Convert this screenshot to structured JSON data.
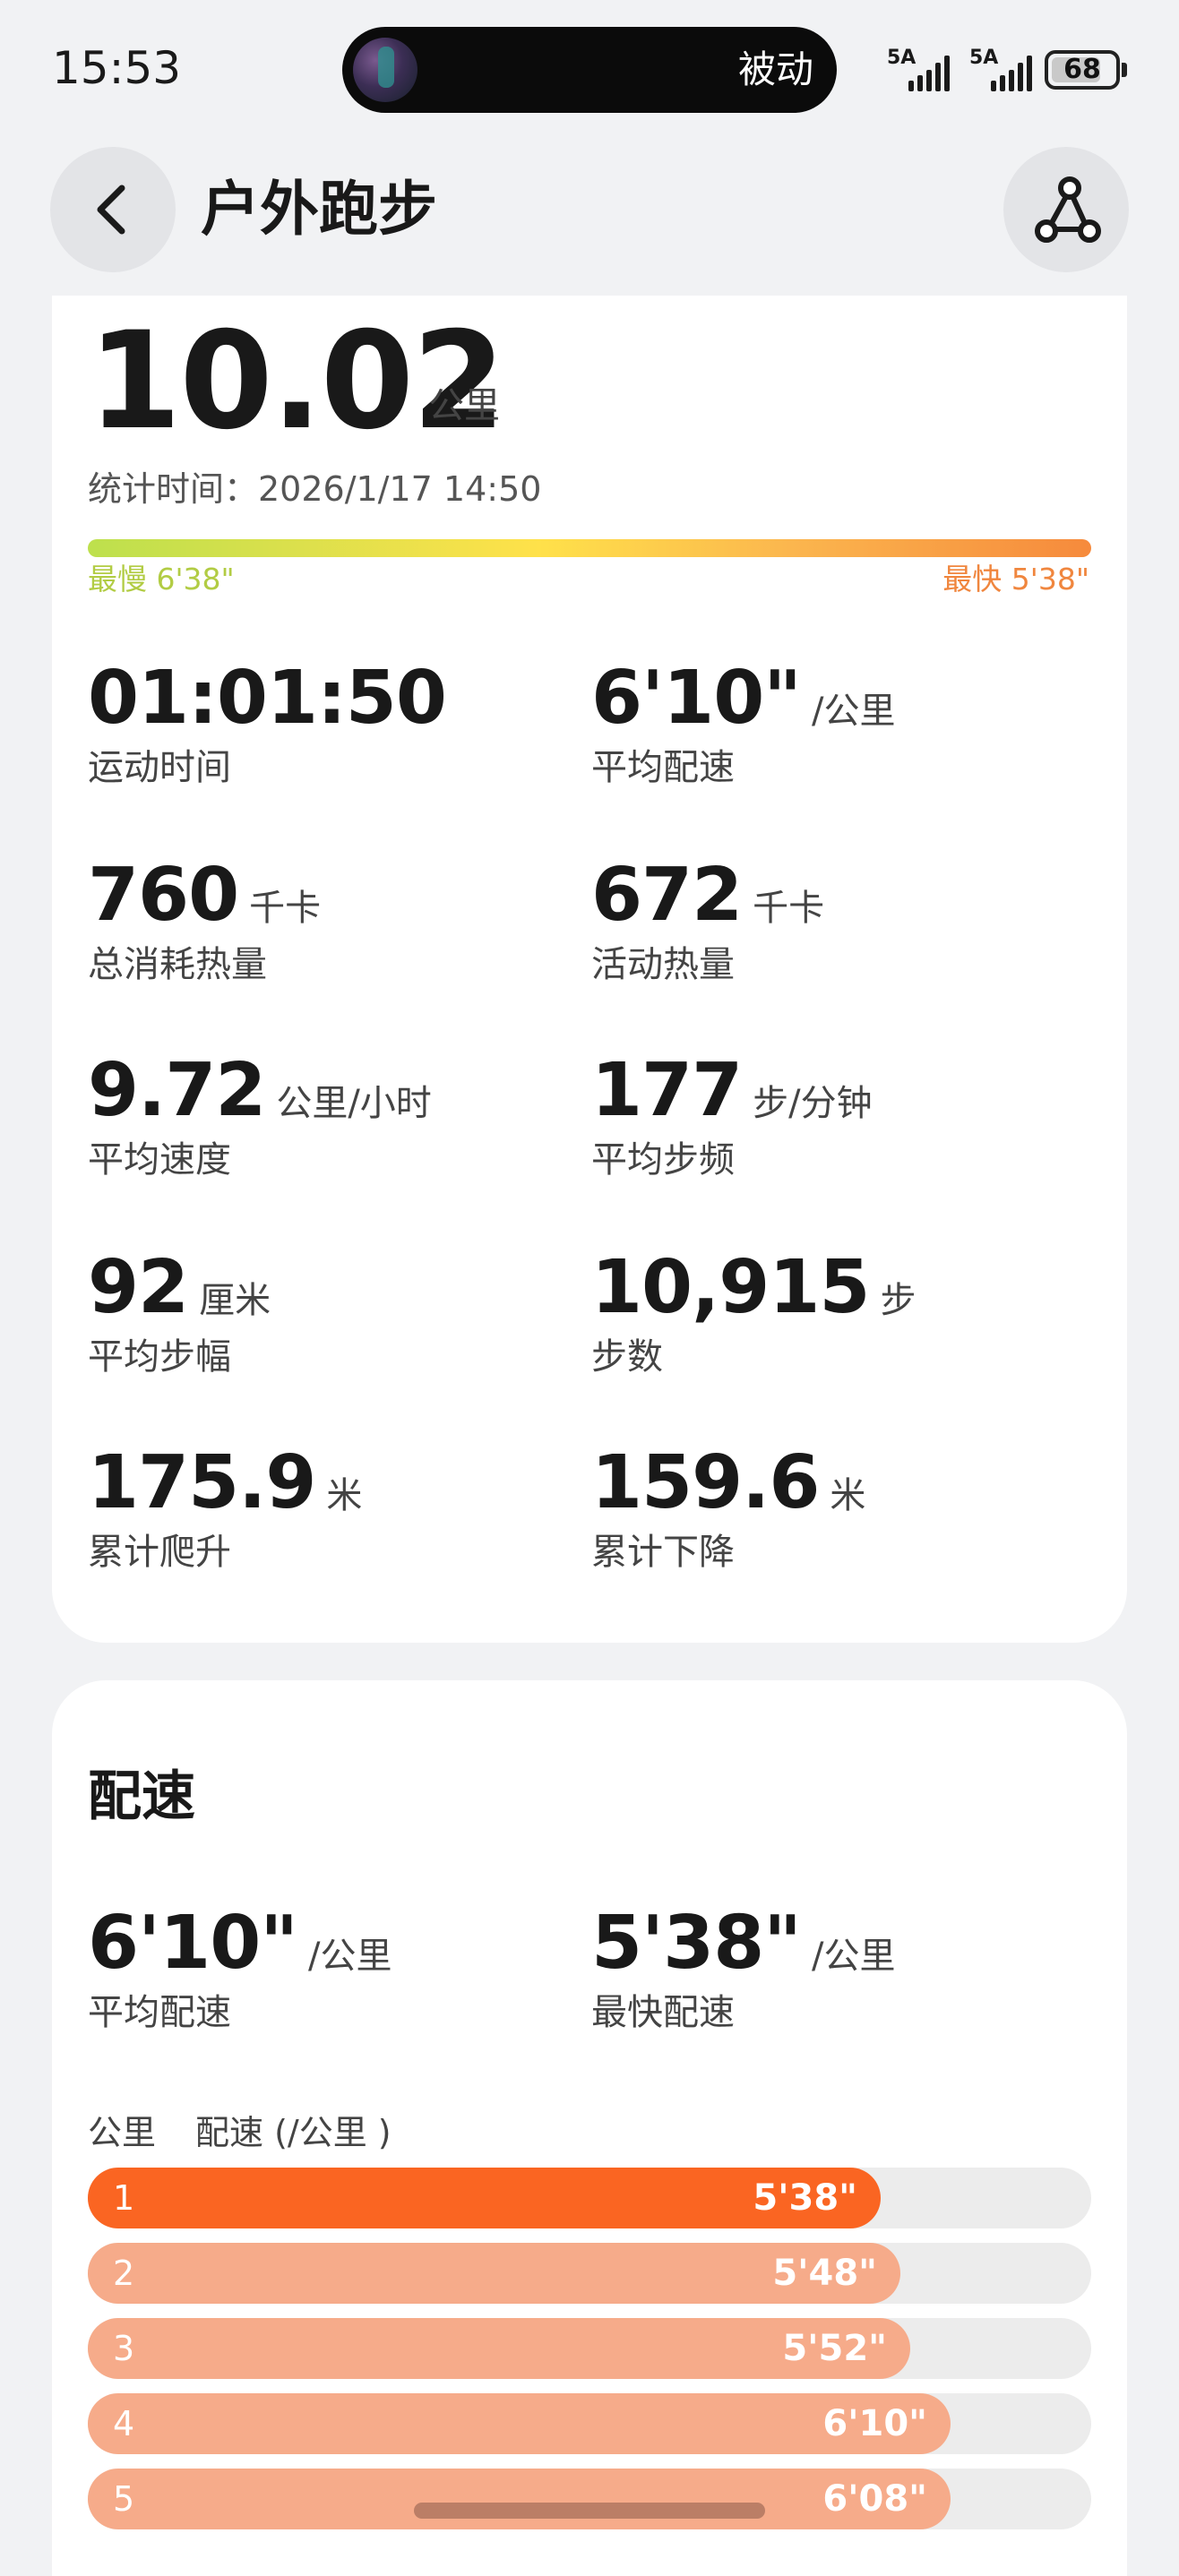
{
  "status_bar": {
    "time": "15:53",
    "activity_label": "被动",
    "signal_1": "5A",
    "signal_2": "5A",
    "battery": "68"
  },
  "header": {
    "title": "户外跑步",
    "back_icon": "chevron-left-icon",
    "share_icon": "route-share-icon"
  },
  "summary": {
    "distance": "10.02",
    "distance_unit": "公里",
    "stat_time": "统计时间：2026/1/17 14:50",
    "slowest": "最慢 6'38\"",
    "fastest": "最快 5'38\""
  },
  "metrics": [
    {
      "value": "01:01:50",
      "unit": "",
      "label": "运动时间"
    },
    {
      "value": "6'10\"",
      "unit": "/公里",
      "label": "平均配速"
    },
    {
      "value": "760",
      "unit": "千卡",
      "label": "总消耗热量"
    },
    {
      "value": "672",
      "unit": "千卡",
      "label": "活动热量"
    },
    {
      "value": "9.72",
      "unit": "公里/小时",
      "label": "平均速度"
    },
    {
      "value": "177",
      "unit": "步/分钟",
      "label": "平均步频"
    },
    {
      "value": "92",
      "unit": "厘米",
      "label": "平均步幅"
    },
    {
      "value": "10,915",
      "unit": "步",
      "label": "步数"
    },
    {
      "value": "175.9",
      "unit": "米",
      "label": "累计爬升"
    },
    {
      "value": "159.6",
      "unit": "米",
      "label": "累计下降"
    }
  ],
  "pace_section": {
    "title": "配速",
    "avg": {
      "value": "6'10\"",
      "unit": "/公里",
      "label": "平均配速"
    },
    "fastest": {
      "value": "5'38\"",
      "unit": "/公里",
      "label": "最快配速"
    },
    "col_km": "公里",
    "col_pace": "配速 (/公里 )",
    "rows": [
      {
        "km": "1",
        "pace": "5'38\"",
        "fraction": 0.79,
        "fastest": true
      },
      {
        "km": "2",
        "pace": "5'48\"",
        "fraction": 0.81,
        "fastest": false
      },
      {
        "km": "3",
        "pace": "5'52\"",
        "fraction": 0.82,
        "fastest": false
      },
      {
        "km": "4",
        "pace": "6'10\"",
        "fraction": 0.86,
        "fastest": false
      },
      {
        "km": "5",
        "pace": "6'08\"",
        "fraction": 0.86,
        "fastest": false
      }
    ]
  },
  "colors": {
    "fastest_bar": "#fa6522",
    "normal_bar": "#f6ab8a",
    "track": "#ececec"
  }
}
